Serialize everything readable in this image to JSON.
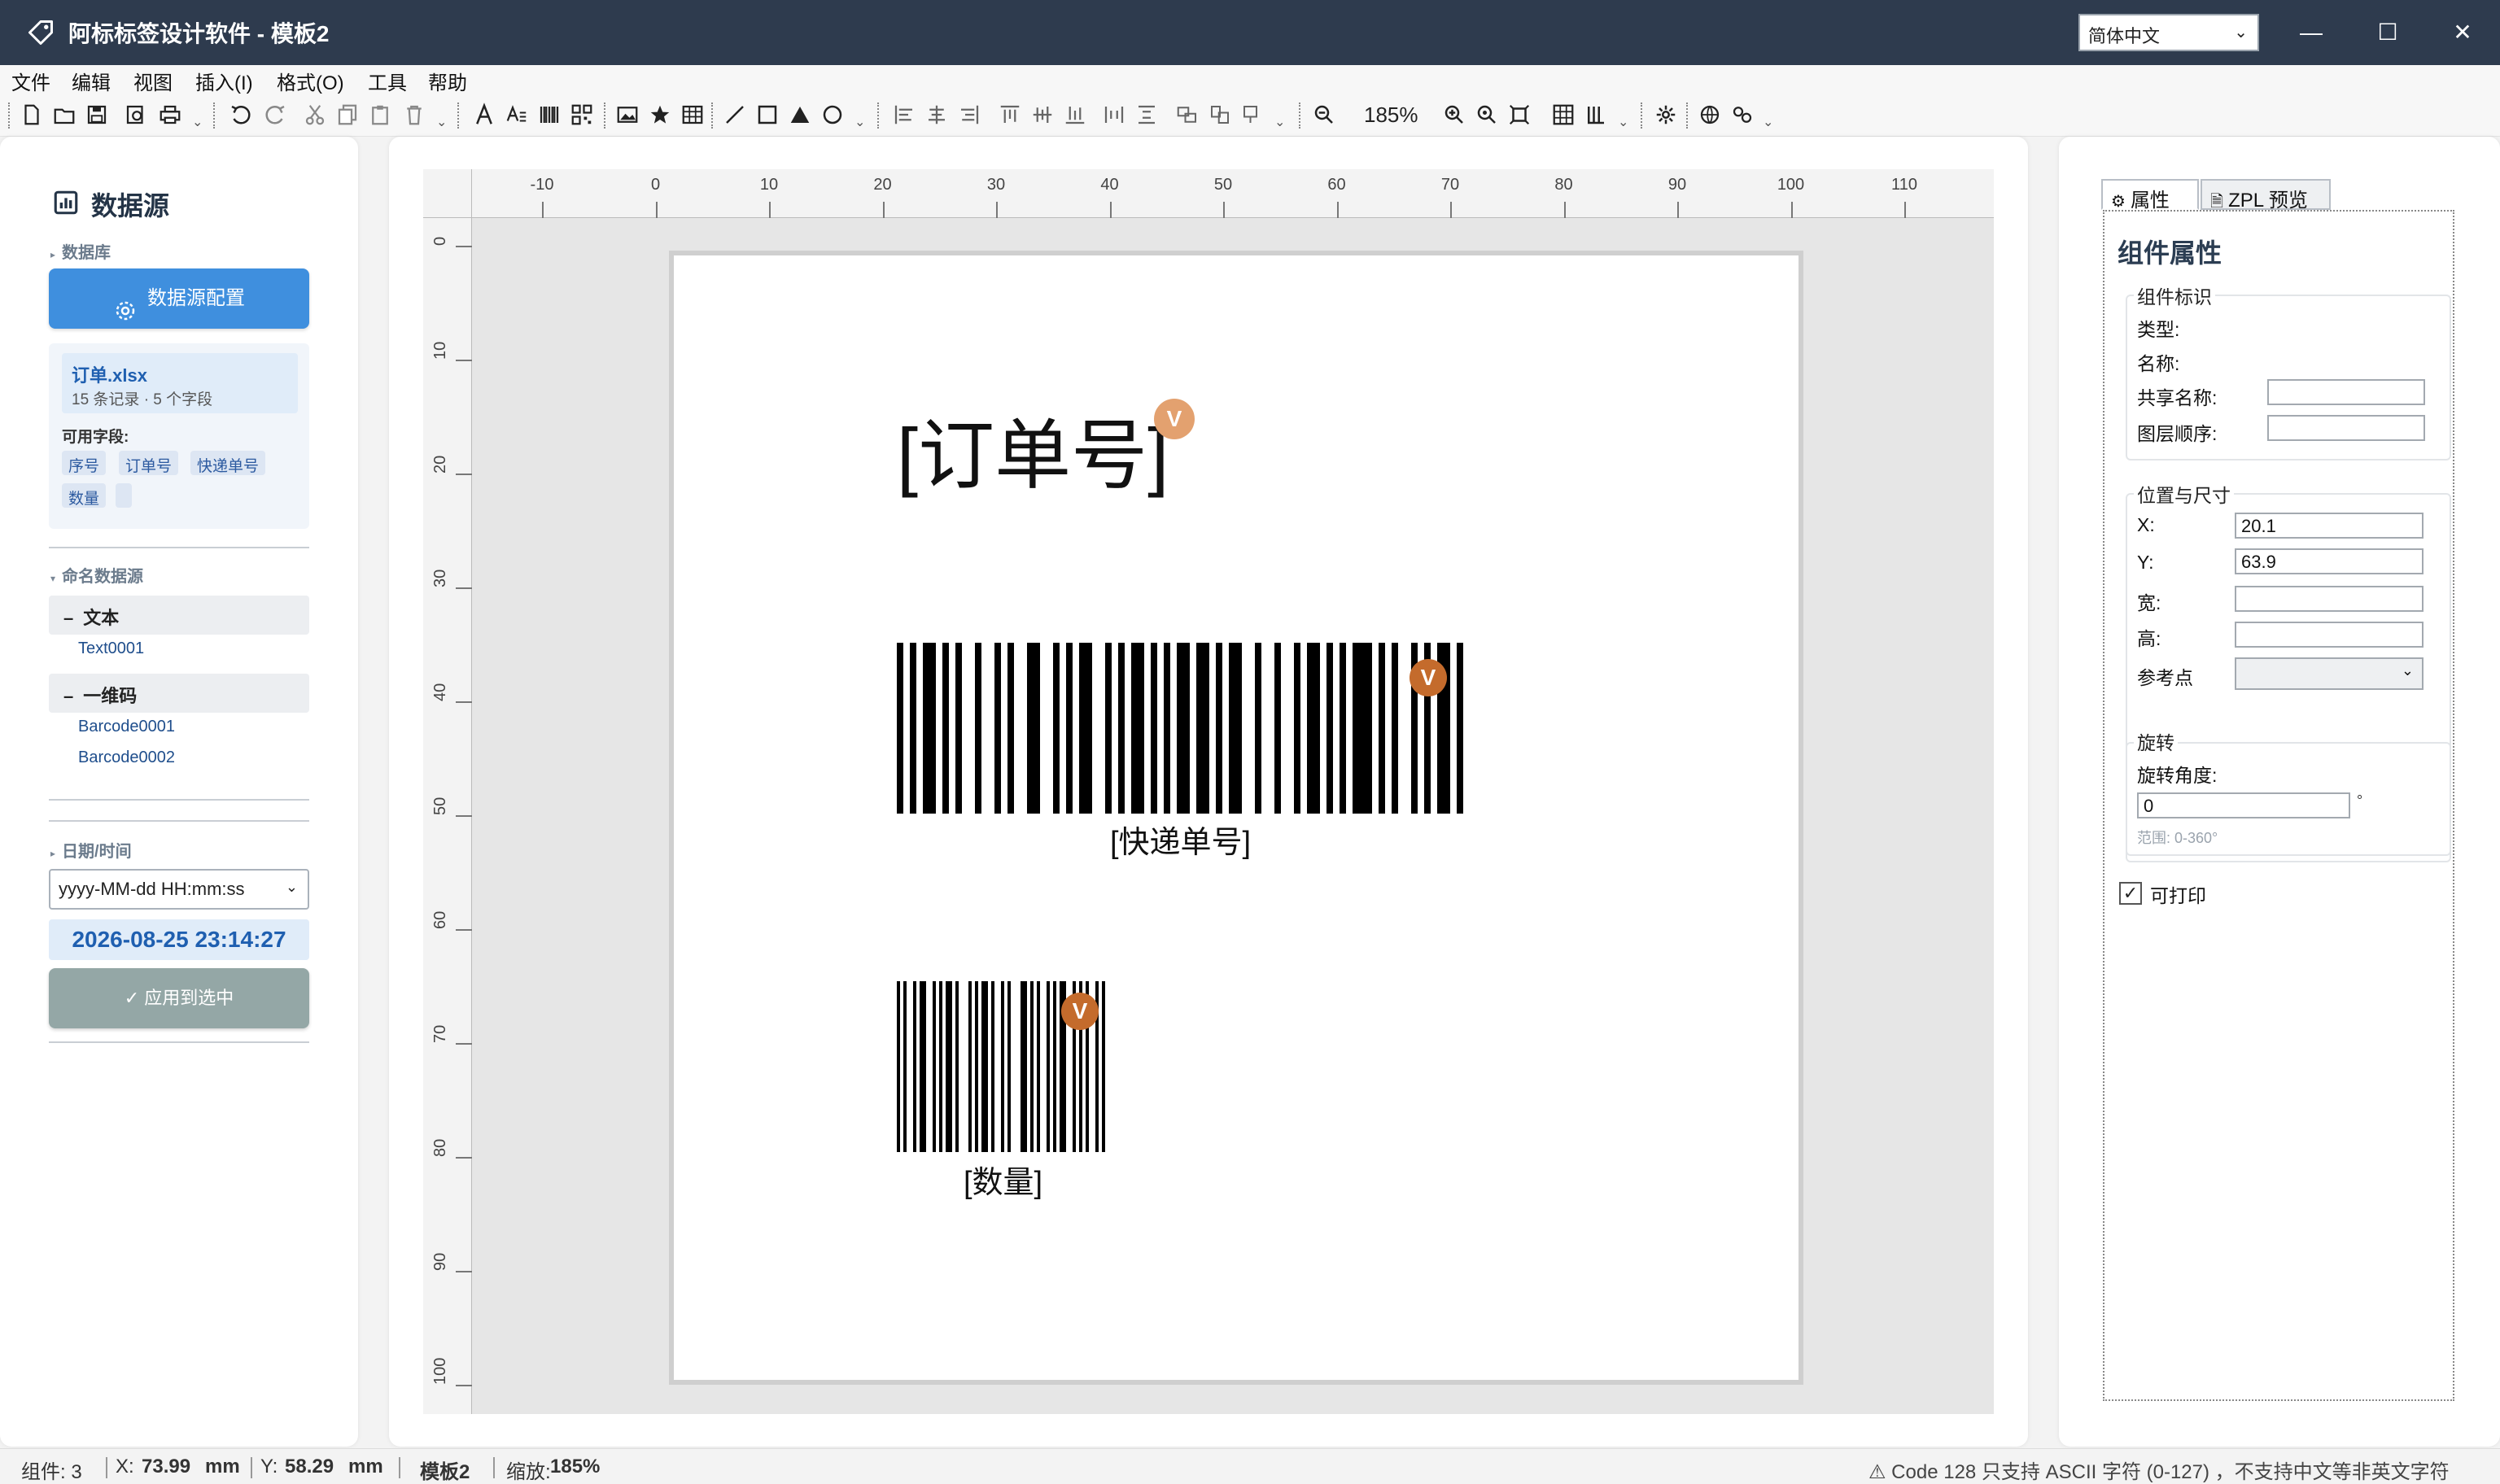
{
  "window": {
    "title": "阿标标签设计软件 - 模板2",
    "language": "简体中文",
    "minimize": "—",
    "maximize": "☐",
    "close": "✕"
  },
  "menu": [
    "文件",
    "编辑",
    "视图",
    "插入(I)",
    "格式(O)",
    "工具",
    "帮助"
  ],
  "toolbar": {
    "zoom": "185%"
  },
  "left_panel": {
    "title": "数据源",
    "database_label": "数据库",
    "config_button": "数据源配置",
    "file": {
      "name": "订单.xlsx",
      "meta": "15 条记录 · 5 个字段"
    },
    "fields_label": "可用字段:",
    "fields": [
      "序号",
      "订单号",
      "快递单号",
      "数量",
      ""
    ],
    "named_sources_label": "命名数据源",
    "groups": [
      {
        "label": "文本",
        "items": [
          "Text0001"
        ]
      },
      {
        "label": "一维码",
        "items": [
          "Barcode0001",
          "Barcode0002"
        ]
      }
    ],
    "datetime_label": "日期/时间",
    "date_format": "yyyy-MM-dd HH:mm:ss",
    "date_now": "2026-08-25 23:14:27",
    "apply_button": "✓ 应用到选中"
  },
  "canvas": {
    "ruler_top": [
      "-10",
      "0",
      "10",
      "20",
      "30",
      "40",
      "50",
      "60",
      "70",
      "80",
      "90",
      "100",
      "110"
    ],
    "ruler_left": [
      "0",
      "10",
      "20",
      "30",
      "40",
      "50",
      "60",
      "70",
      "80",
      "90",
      "100"
    ],
    "text_field": "[订单号]",
    "barcode1_label": "[快递单号]",
    "barcode2_label": "[数量]",
    "badge": "V",
    "badge_color": "#e3a16f"
  },
  "right_panel": {
    "tab_props": "属性",
    "tab_zpl": "ZPL 预览",
    "title": "组件属性",
    "identity": {
      "group": "组件标识",
      "type_label": "类型:",
      "name_label": "名称:",
      "shared_name_label": "共享名称:",
      "layer_label": "图层顺序:",
      "shared_name": "",
      "layer": ""
    },
    "position": {
      "group": "位置与尺寸",
      "x_label": "X:",
      "y_label": "Y:",
      "w_label": "宽:",
      "h_label": "高:",
      "ref_label": "参考点",
      "x": "20.1",
      "y": "63.9",
      "w": "",
      "h": ""
    },
    "rotation": {
      "group": "旋转",
      "angle_label": "旋转角度:",
      "angle": "0",
      "unit": "°",
      "hint": "范围: 0-360°"
    },
    "printable_label": "可打印",
    "printable": true
  },
  "status": {
    "components": "组件: 3",
    "x_label": "X:",
    "x": "73.99",
    "x_unit": "mm",
    "y_label": "Y:",
    "y": "58.29",
    "y_unit": "mm",
    "template": "模板2",
    "zoom_label": "缩放:",
    "zoom": "185%",
    "warning": "⚠ Code 128 只支持 ASCII 字符 (0-127) ，不支持中文等非英文字符"
  }
}
